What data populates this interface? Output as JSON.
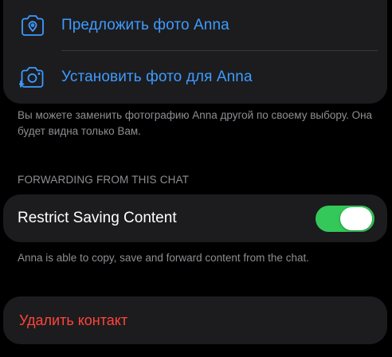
{
  "photo_section": {
    "suggest_label": "Предложить фото Anna",
    "set_label": "Установить фото для Anna",
    "suggest_icon": "camera-suggest-icon",
    "set_icon": "camera-set-icon",
    "note": "Вы можете заменить фотографию Anna другой по своему выбору. Она будет видна только Вам."
  },
  "forwarding_section": {
    "header": "FORWARDING FROM THIS CHAT",
    "restrict_label": "Restrict Saving Content",
    "restrict_enabled": true,
    "note": "Anna is able to copy, save and forward content from the chat."
  },
  "delete_contact": {
    "label": "Удалить контакт"
  },
  "colors": {
    "background": "#000000",
    "card": "#1c1c1e",
    "accent_blue": "#3e9bff",
    "toggle_on": "#34c759",
    "destructive": "#ff453a",
    "secondary_text": "#8e8e93"
  }
}
